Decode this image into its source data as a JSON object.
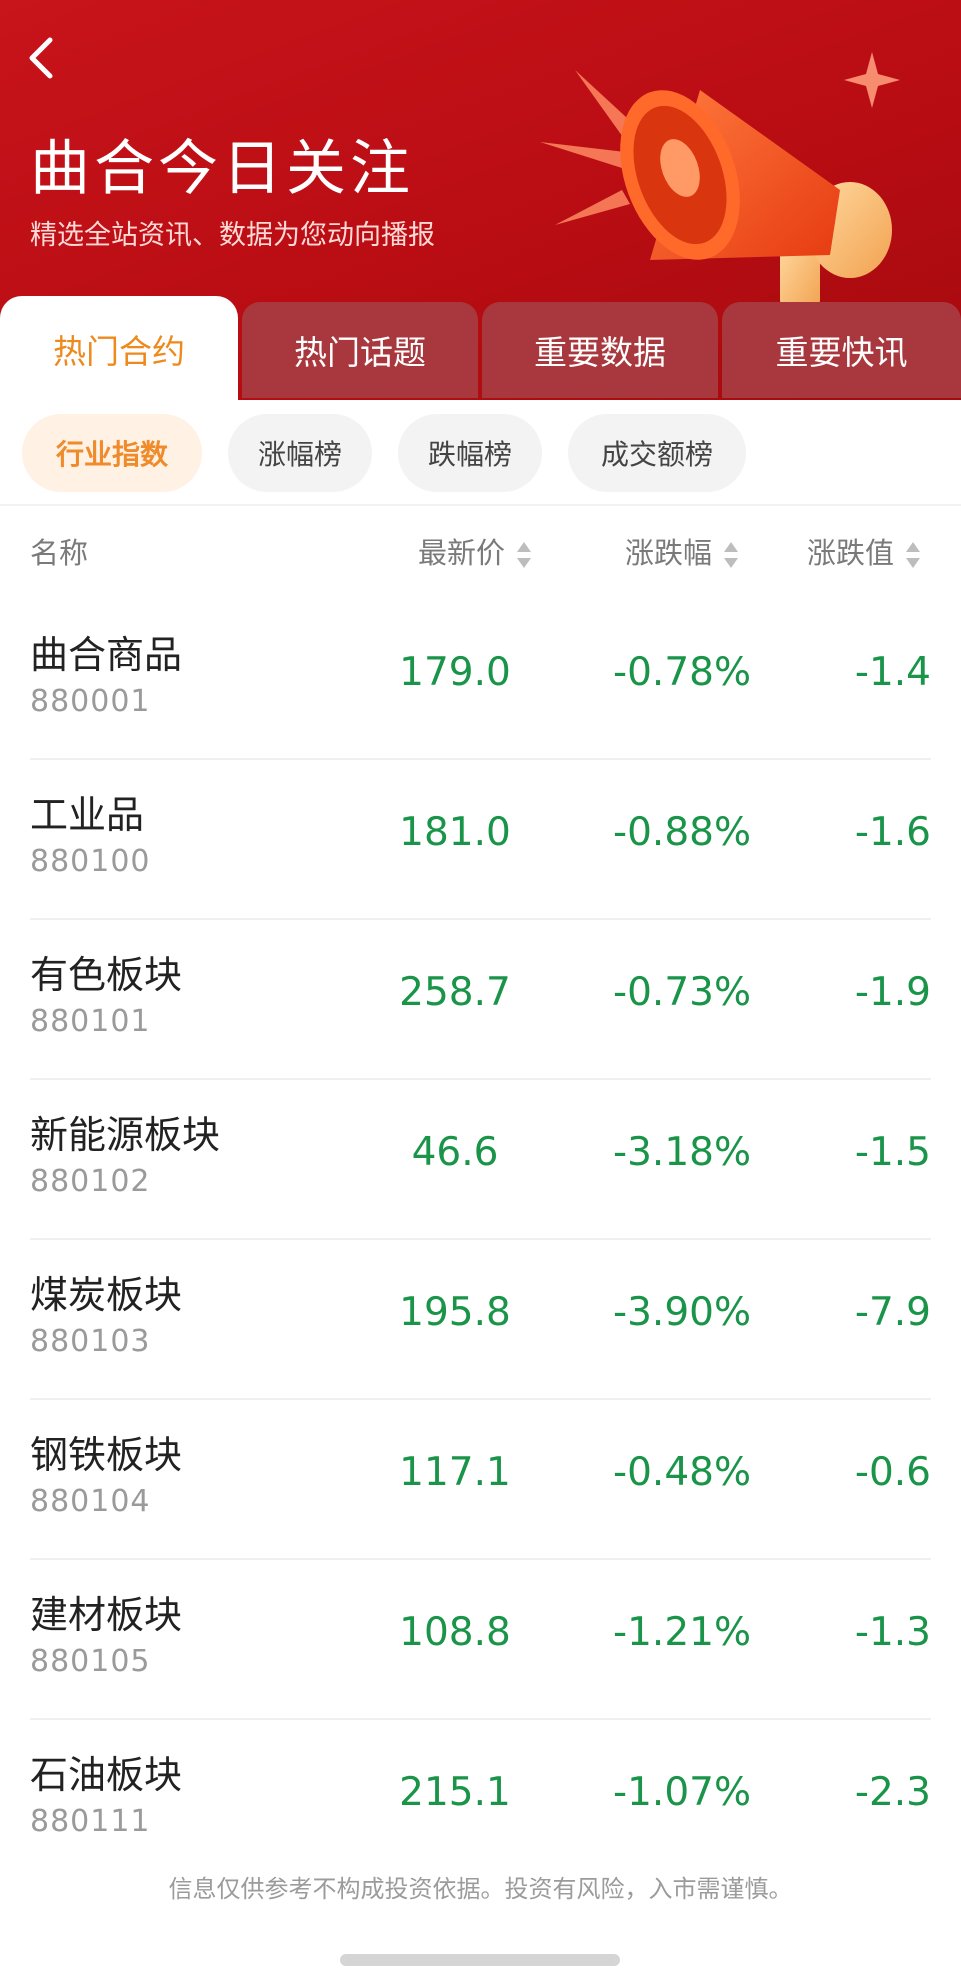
{
  "header": {
    "title": "曲合今日关注",
    "subtitle": "精选全站资讯、数据为您动向播报"
  },
  "tabs": [
    {
      "label": "热门合约",
      "active": true
    },
    {
      "label": "热门话题",
      "active": false
    },
    {
      "label": "重要数据",
      "active": false
    },
    {
      "label": "重要快讯",
      "active": false
    }
  ],
  "chips": [
    {
      "label": "行业指数",
      "active": true
    },
    {
      "label": "涨幅榜",
      "active": false
    },
    {
      "label": "跌幅榜",
      "active": false
    },
    {
      "label": "成交额榜",
      "active": false
    }
  ],
  "table": {
    "headers": {
      "name": "名称",
      "price": "最新价",
      "pct": "涨跌幅",
      "chg": "涨跌值"
    },
    "rows": [
      {
        "name": "曲合商品",
        "code": "880001",
        "price": "179.0",
        "pct": "-0.78%",
        "chg": "-1.4"
      },
      {
        "name": "工业品",
        "code": "880100",
        "price": "181.0",
        "pct": "-0.88%",
        "chg": "-1.6"
      },
      {
        "name": "有色板块",
        "code": "880101",
        "price": "258.7",
        "pct": "-0.73%",
        "chg": "-1.9"
      },
      {
        "name": "新能源板块",
        "code": "880102",
        "price": "46.6",
        "pct": "-3.18%",
        "chg": "-1.5"
      },
      {
        "name": "煤炭板块",
        "code": "880103",
        "price": "195.8",
        "pct": "-3.90%",
        "chg": "-7.9"
      },
      {
        "name": "钢铁板块",
        "code": "880104",
        "price": "117.1",
        "pct": "-0.48%",
        "chg": "-0.6"
      },
      {
        "name": "建材板块",
        "code": "880105",
        "price": "108.8",
        "pct": "-1.21%",
        "chg": "-1.3"
      },
      {
        "name": "石油板块",
        "code": "880111",
        "price": "215.1",
        "pct": "-1.07%",
        "chg": "-2.3"
      }
    ]
  },
  "disclaimer": "信息仅供参考不构成投资依据。投资有风险，入市需谨慎。",
  "colors": {
    "accent": "#ee8a1d",
    "header_red": "#c8141b",
    "down_green": "#1a9448"
  },
  "icons": [
    "back-arrow-icon",
    "megaphone-illustration",
    "sort-icon"
  ]
}
